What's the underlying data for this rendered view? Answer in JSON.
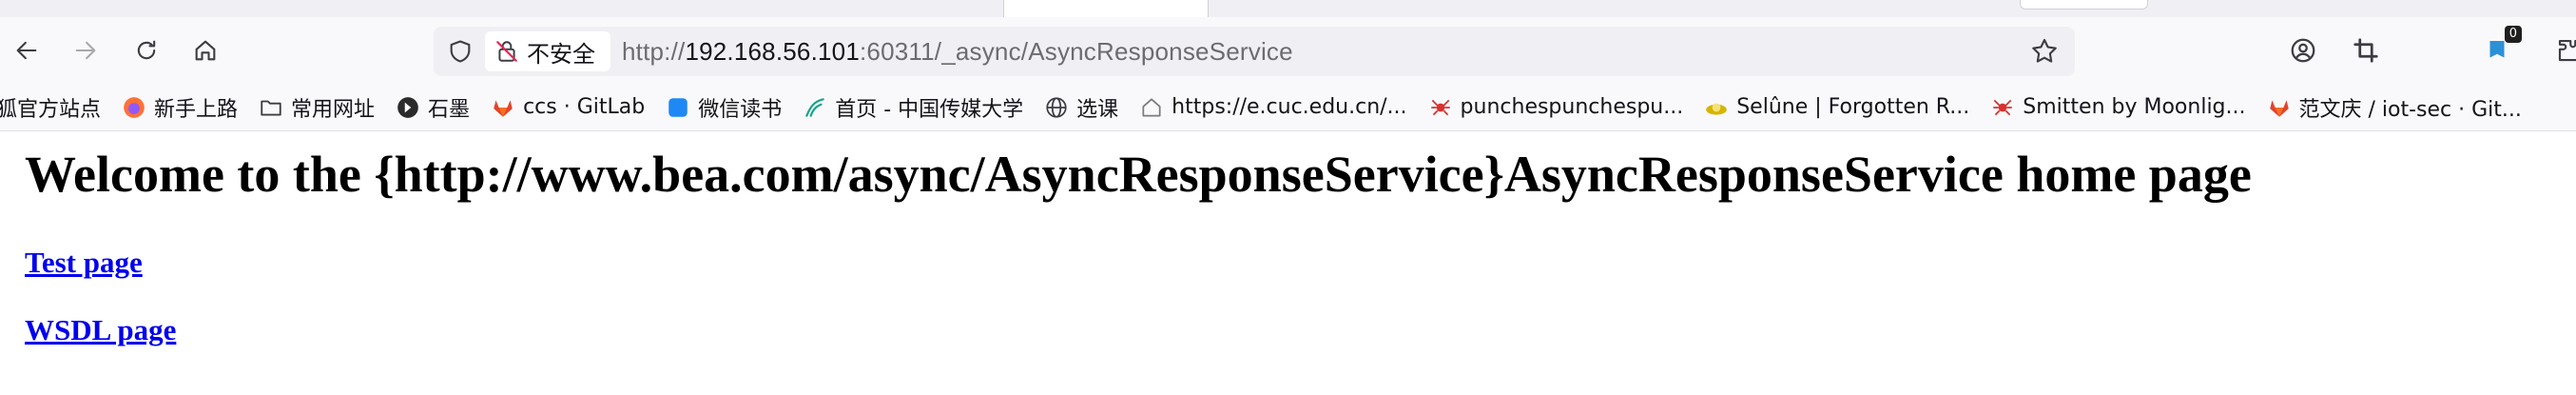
{
  "address_bar": {
    "security_label": "不安全",
    "url_scheme": "http://",
    "url_host": "192.168.56.101",
    "url_rest": ":60311/_async/AsyncResponseService"
  },
  "toolbar": {
    "extension_badge": "0"
  },
  "bookmarks": [
    {
      "label": "狐官方站点",
      "icon": "firefox-site-icon"
    },
    {
      "label": "新手上路",
      "icon": "firefox-icon"
    },
    {
      "label": "常用网址",
      "icon": "folder-icon"
    },
    {
      "label": "石墨",
      "icon": "shimo-icon"
    },
    {
      "label": "ccs · GitLab",
      "icon": "gitlab-icon"
    },
    {
      "label": "微信读书",
      "icon": "weread-icon"
    },
    {
      "label": "首页 - 中国传媒大学",
      "icon": "cuc-icon"
    },
    {
      "label": "选课",
      "icon": "globe-icon"
    },
    {
      "label": "https://e.cuc.edu.cn/...",
      "icon": "home-page-icon"
    },
    {
      "label": "punchespunchespu...",
      "icon": "spider-icon"
    },
    {
      "label": "Selûne | Forgotten R...",
      "icon": "moon-icon"
    },
    {
      "label": "Smitten by Moonlig...",
      "icon": "spider-icon"
    },
    {
      "label": "范文庆 / iot-sec · Git...",
      "icon": "gitlab-icon"
    }
  ],
  "page": {
    "heading": "Welcome to the {http://www.bea.com/async/AsyncResponseService}AsyncResponseService home page",
    "test_link": "Test page",
    "wsdl_link": "WSDL page"
  }
}
